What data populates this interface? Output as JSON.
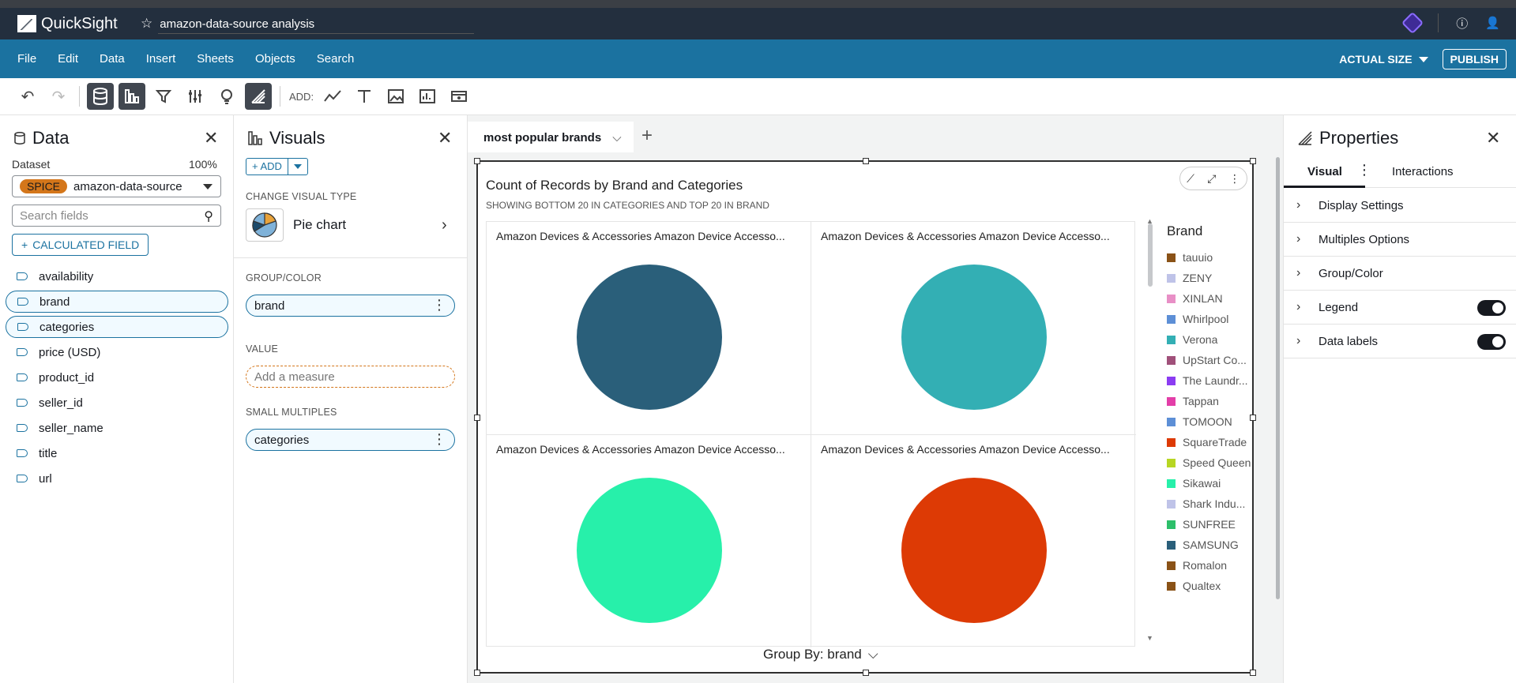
{
  "app": {
    "name": "QuickSight",
    "analysis_title": "amazon-data-source analysis"
  },
  "menubar": {
    "items": [
      "File",
      "Edit",
      "Data",
      "Insert",
      "Sheets",
      "Objects",
      "Search"
    ],
    "zoom_label": "ACTUAL SIZE",
    "publish_label": "PUBLISH"
  },
  "toolbar": {
    "add_label": "ADD:"
  },
  "data_panel": {
    "title": "Data",
    "dataset_label": "Dataset",
    "dataset_percent": "100%",
    "spice_badge": "SPICE",
    "dataset_name": "amazon-data-source",
    "search_placeholder": "Search fields",
    "calculated_field_label": "CALCULATED FIELD",
    "fields": [
      {
        "name": "availability",
        "selected": false
      },
      {
        "name": "brand",
        "selected": true
      },
      {
        "name": "categories",
        "selected": true
      },
      {
        "name": "price (USD)",
        "selected": false
      },
      {
        "name": "product_id",
        "selected": false
      },
      {
        "name": "seller_id",
        "selected": false
      },
      {
        "name": "seller_name",
        "selected": false
      },
      {
        "name": "title",
        "selected": false
      },
      {
        "name": "url",
        "selected": false
      }
    ]
  },
  "visuals_panel": {
    "title": "Visuals",
    "add_label": "ADD",
    "change_type_label": "CHANGE VISUAL TYPE",
    "visual_type": "Pie chart",
    "group_color_label": "GROUP/COLOR",
    "group_color_field": "brand",
    "value_label": "VALUE",
    "value_placeholder": "Add a measure",
    "small_multiples_label": "SMALL MULTIPLES",
    "small_multiples_field": "categories"
  },
  "sheet": {
    "tab_name": "most popular brands"
  },
  "visual": {
    "title": "Count of Records by Brand and Categories",
    "subtitle": "SHOWING BOTTOM 20 IN CATEGORIES AND TOP 20 IN BRAND",
    "group_by_label": "Group By: brand",
    "cells": [
      {
        "title": "Amazon Devices & Accessories Amazon Device Accesso...",
        "color": "#2a5f7a"
      },
      {
        "title": "Amazon Devices & Accessories Amazon Device Accesso...",
        "color": "#33afb4"
      },
      {
        "title": "Amazon Devices & Accessories Amazon Device Accesso...",
        "color": "#27f0aa"
      },
      {
        "title": "Amazon Devices & Accessories Amazon Device Accesso...",
        "color": "#dd3a05"
      }
    ],
    "legend": {
      "title": "Brand",
      "items": [
        {
          "label": "tauuio",
          "color": "#8a5217"
        },
        {
          "label": "ZENY",
          "color": "#bfc3e8"
        },
        {
          "label": "XINLAN",
          "color": "#e88fc6"
        },
        {
          "label": "Whirlpool",
          "color": "#5d8fd6"
        },
        {
          "label": "Verona",
          "color": "#33afb4"
        },
        {
          "label": "UpStart Co...",
          "color": "#a0507a"
        },
        {
          "label": "The Laundr...",
          "color": "#8b3cf2"
        },
        {
          "label": "Tappan",
          "color": "#e33ea8"
        },
        {
          "label": "TOMOON",
          "color": "#5d8fd6"
        },
        {
          "label": "SquareTrade",
          "color": "#dd3a05"
        },
        {
          "label": "Speed Queen",
          "color": "#b7d623"
        },
        {
          "label": "Sikawai",
          "color": "#27f0aa"
        },
        {
          "label": "Shark Indu...",
          "color": "#bfc3e8"
        },
        {
          "label": "SUNFREE",
          "color": "#2dbf6a"
        },
        {
          "label": "SAMSUNG",
          "color": "#2a5f7a"
        },
        {
          "label": "Romalon",
          "color": "#8a5217"
        },
        {
          "label": "Qualtex",
          "color": "#8a5217"
        }
      ]
    }
  },
  "properties_panel": {
    "title": "Properties",
    "tabs": [
      "Visual",
      "Interactions"
    ],
    "sections": [
      {
        "label": "Display Settings",
        "toggle": false
      },
      {
        "label": "Multiples Options",
        "toggle": false
      },
      {
        "label": "Group/Color",
        "toggle": false
      },
      {
        "label": "Legend",
        "toggle": true
      },
      {
        "label": "Data labels",
        "toggle": true
      }
    ]
  }
}
